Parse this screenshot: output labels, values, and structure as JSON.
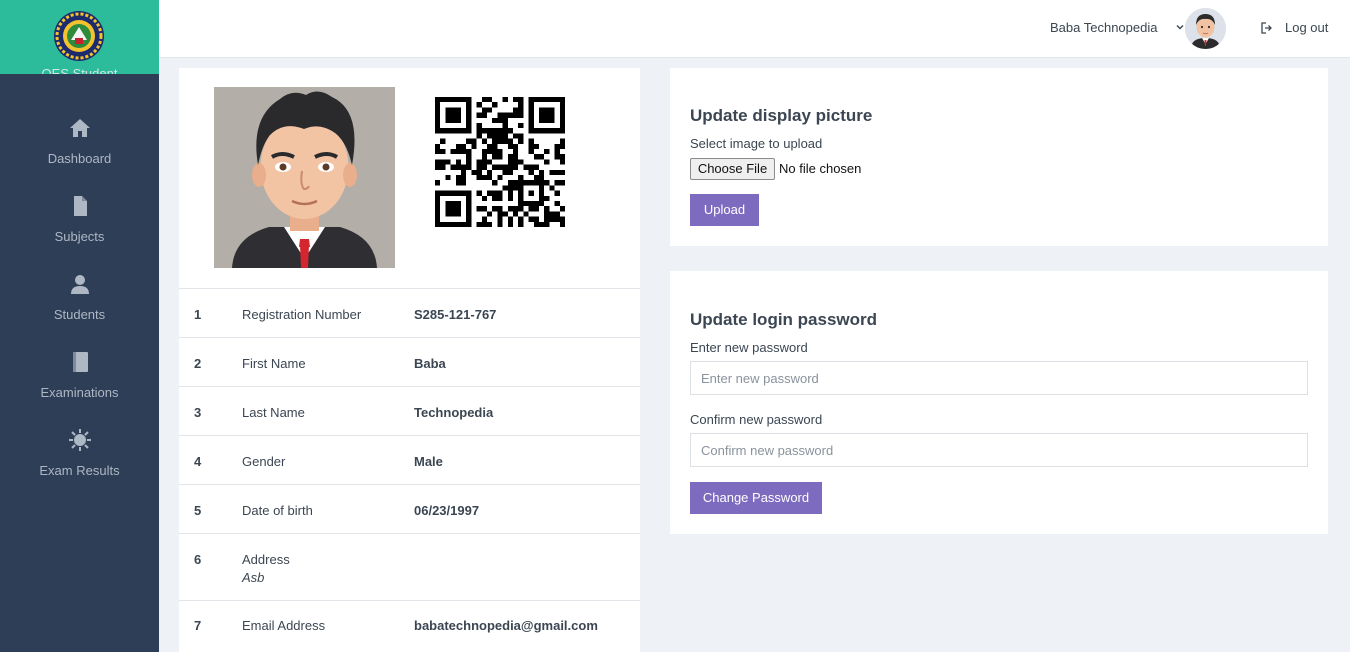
{
  "sidebar": {
    "brand_name": "OES Student",
    "items": [
      {
        "label": "Dashboard",
        "icon": "home-icon"
      },
      {
        "label": "Subjects",
        "icon": "file-icon"
      },
      {
        "label": "Students",
        "icon": "user-icon"
      },
      {
        "label": "Examinations",
        "icon": "book-icon"
      },
      {
        "label": "Exam Results",
        "icon": "sun-icon"
      }
    ]
  },
  "topbar": {
    "user_name": "Baba Technopedia",
    "logout_label": "Log out"
  },
  "profile": {
    "rows": [
      {
        "num": "1",
        "label": "Registration Number",
        "value": "S285-121-767"
      },
      {
        "num": "2",
        "label": "First Name",
        "value": "Baba"
      },
      {
        "num": "3",
        "label": "Last Name",
        "value": "Technopedia"
      },
      {
        "num": "4",
        "label": "Gender",
        "value": "Male"
      },
      {
        "num": "5",
        "label": "Date of birth",
        "value": "06/23/1997"
      },
      {
        "num": "6",
        "label": "Address",
        "sub": "Asb"
      },
      {
        "num": "7",
        "label": "Email Address",
        "value": "babatechnopedia@gmail.com"
      }
    ]
  },
  "display_picture": {
    "title": "Update display picture",
    "select_label": "Select image to upload",
    "choose_file_label": "Choose File",
    "file_status": "No file chosen",
    "upload_label": "Upload"
  },
  "password": {
    "title": "Update login password",
    "new_label": "Enter new password",
    "new_placeholder": "Enter new password",
    "confirm_label": "Confirm new password",
    "confirm_placeholder": "Confirm new password",
    "button_label": "Change Password"
  },
  "colors": {
    "sidebar_bg": "#2e3e56",
    "brand_bg": "#2cbc9c",
    "primary_button": "#7c6bbf",
    "page_bg": "#eef1f6"
  }
}
